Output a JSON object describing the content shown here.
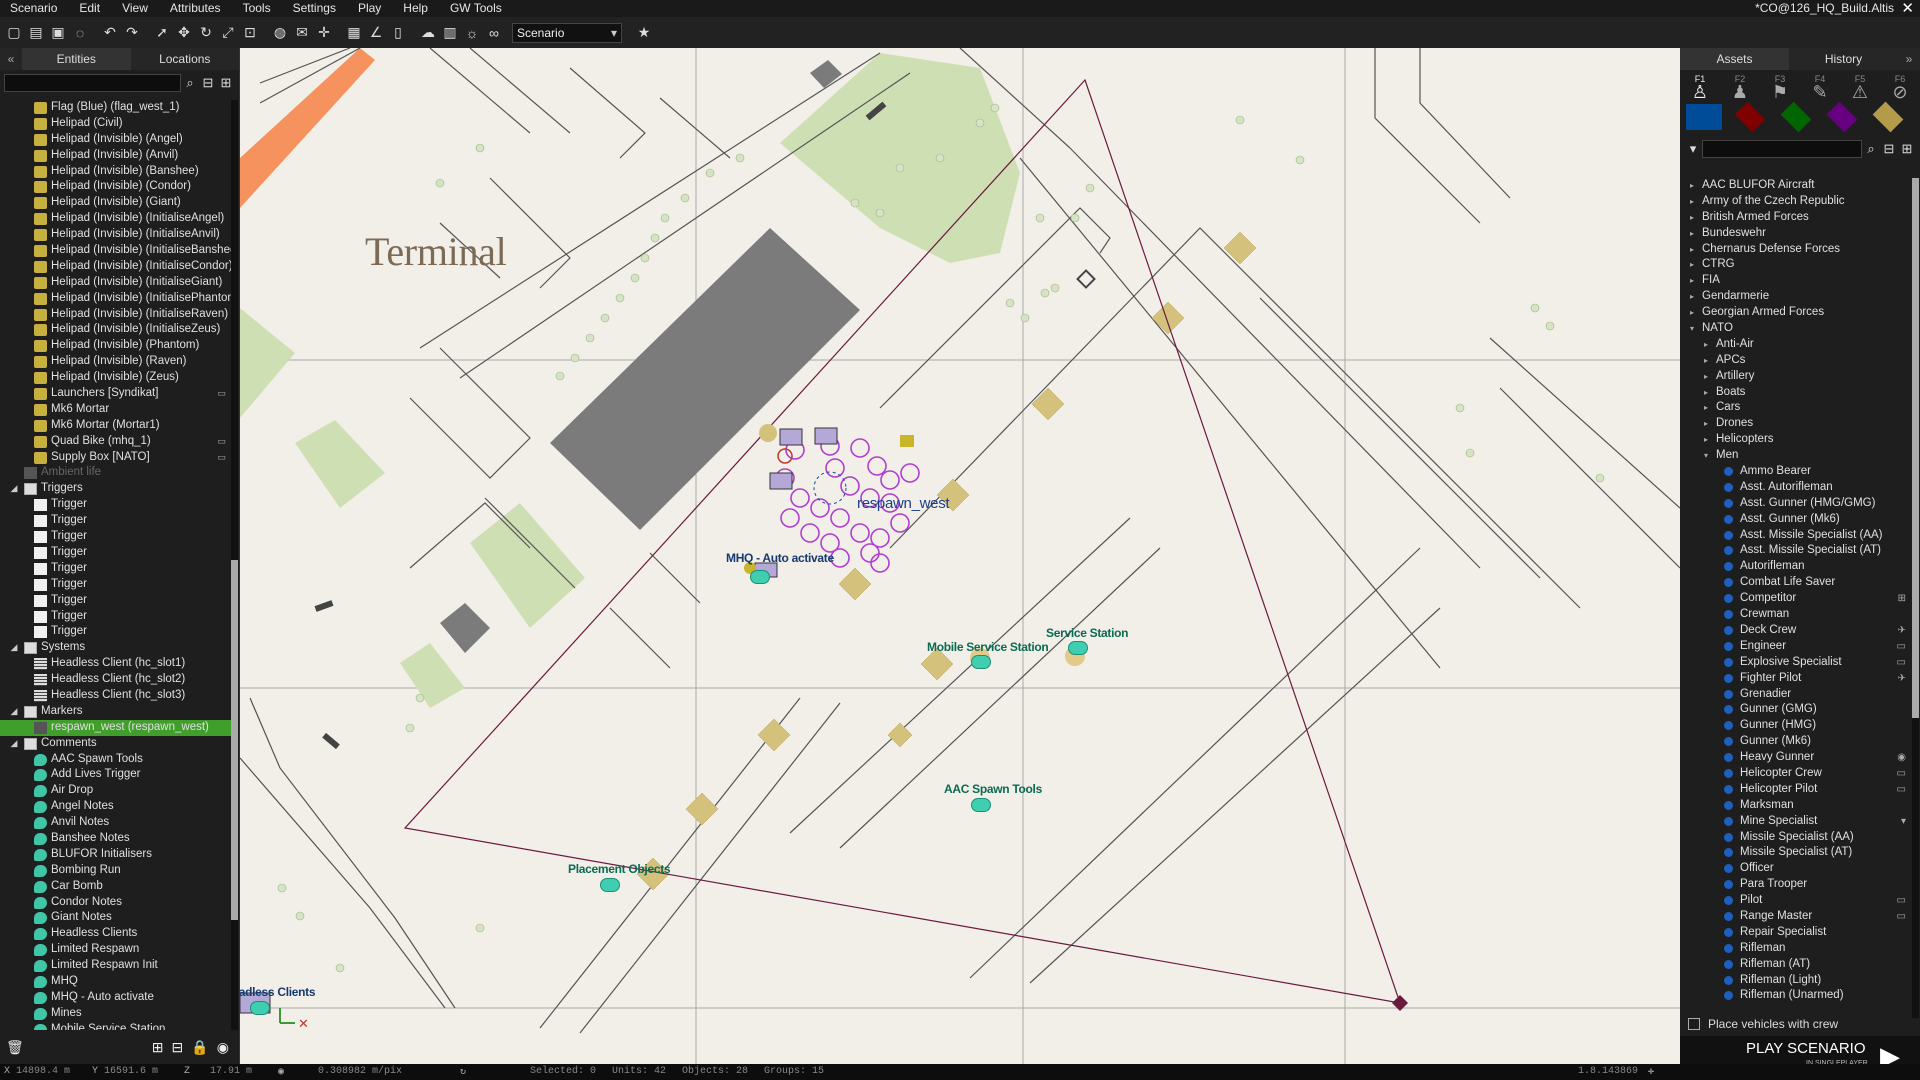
{
  "menu": [
    "Scenario",
    "Edit",
    "View",
    "Attributes",
    "Tools",
    "Settings",
    "Play",
    "Help",
    "GW Tools"
  ],
  "mission_title": "*CO@126_HQ_Build.Altis",
  "toolbar": {
    "layer_select": "Scenario"
  },
  "left_panel": {
    "tabs": [
      "Entities",
      "Locations"
    ],
    "rows": [
      {
        "label": "Flag (Blue) (flag_west_1)",
        "indent": 50,
        "icon": "flag",
        "depth": 2
      },
      {
        "label": "Helipad (Civil)",
        "icon": "flag"
      },
      {
        "label": "Helipad (Invisible) (Angel)",
        "icon": "flag"
      },
      {
        "label": "Helipad (Invisible) (Anvil)",
        "icon": "flag"
      },
      {
        "label": "Helipad (Invisible) (Banshee)",
        "icon": "flag"
      },
      {
        "label": "Helipad (Invisible) (Condor)",
        "icon": "flag"
      },
      {
        "label": "Helipad (Invisible) (Giant)",
        "icon": "flag"
      },
      {
        "label": "Helipad (Invisible) (InitialiseAngel)",
        "icon": "flag"
      },
      {
        "label": "Helipad (Invisible) (InitialiseAnvil)",
        "icon": "flag"
      },
      {
        "label": "Helipad (Invisible) (InitialiseBanshee)",
        "icon": "flag"
      },
      {
        "label": "Helipad (Invisible) (InitialiseCondor)",
        "icon": "flag"
      },
      {
        "label": "Helipad (Invisible) (InitialiseGiant)",
        "icon": "flag"
      },
      {
        "label": "Helipad (Invisible) (InitialisePhantom)",
        "icon": "flag"
      },
      {
        "label": "Helipad (Invisible) (InitialiseRaven)",
        "icon": "flag"
      },
      {
        "label": "Helipad (Invisible) (InitialiseZeus)",
        "icon": "flag"
      },
      {
        "label": "Helipad (Invisible) (Phantom)",
        "icon": "flag"
      },
      {
        "label": "Helipad (Invisible) (Raven)",
        "icon": "flag"
      },
      {
        "label": "Helipad (Invisible) (Zeus)",
        "icon": "flag"
      },
      {
        "label": "Launchers [Syndikat]",
        "icon": "flag",
        "tag": "▭"
      },
      {
        "label": "Mk6 Mortar",
        "icon": "flag"
      },
      {
        "label": "Mk6 Mortar (Mortar1)",
        "icon": "flag"
      },
      {
        "label": "Quad Bike (mhq_1)",
        "icon": "flag",
        "tag": "▭"
      },
      {
        "label": "Supply Box [NATO]",
        "icon": "flag",
        "tag": "▭"
      },
      {
        "label": "Ambient life",
        "icon": "dim",
        "dim": true,
        "lvl": 1
      },
      {
        "label": "Triggers",
        "icon": "folder",
        "lvl": 0,
        "exp": "◢"
      },
      {
        "label": "Trigger",
        "icon": "trig"
      },
      {
        "label": "Trigger",
        "icon": "trig"
      },
      {
        "label": "Trigger",
        "icon": "trig"
      },
      {
        "label": "Trigger",
        "icon": "trig"
      },
      {
        "label": "Trigger",
        "icon": "trig"
      },
      {
        "label": "Trigger",
        "icon": "trig"
      },
      {
        "label": "Trigger",
        "icon": "trig"
      },
      {
        "label": "Trigger",
        "icon": "trig"
      },
      {
        "label": "Trigger",
        "icon": "trig"
      },
      {
        "label": "Systems",
        "icon": "folder",
        "lvl": 0,
        "exp": "◢"
      },
      {
        "label": "Headless Client (hc_slot1)",
        "icon": "hc"
      },
      {
        "label": "Headless Client (hc_slot2)",
        "icon": "hc"
      },
      {
        "label": "Headless Client (hc_slot3)",
        "icon": "hc"
      },
      {
        "label": "Markers",
        "icon": "folder",
        "lvl": 0,
        "exp": "◢"
      },
      {
        "label": "respawn_west (respawn_west)",
        "icon": "dim",
        "selected": true
      },
      {
        "label": "Comments",
        "icon": "folder",
        "lvl": 0,
        "exp": "◢"
      },
      {
        "label": "AAC Spawn Tools",
        "icon": "cmt"
      },
      {
        "label": "Add Lives Trigger",
        "icon": "cmt"
      },
      {
        "label": "Air Drop",
        "icon": "cmt"
      },
      {
        "label": "Angel Notes",
        "icon": "cmt"
      },
      {
        "label": "Anvil Notes",
        "icon": "cmt"
      },
      {
        "label": "Banshee Notes",
        "icon": "cmt"
      },
      {
        "label": "BLUFOR Initialisers",
        "icon": "cmt"
      },
      {
        "label": "Bombing Run",
        "icon": "cmt"
      },
      {
        "label": "Car Bomb",
        "icon": "cmt"
      },
      {
        "label": "Condor Notes",
        "icon": "cmt"
      },
      {
        "label": "Giant Notes",
        "icon": "cmt"
      },
      {
        "label": "Headless Clients",
        "icon": "cmt"
      },
      {
        "label": "Limited Respawn",
        "icon": "cmt"
      },
      {
        "label": "Limited Respawn Init",
        "icon": "cmt"
      },
      {
        "label": "MHQ",
        "icon": "cmt"
      },
      {
        "label": "MHQ - Auto activate",
        "icon": "cmt"
      },
      {
        "label": "Mines",
        "icon": "cmt"
      },
      {
        "label": "Mobile Service Station",
        "icon": "cmt"
      }
    ]
  },
  "map": {
    "location_label": "Terminal",
    "labels": [
      "respawn_west",
      "MHQ - Auto activate",
      "Mobile Service Station",
      "Service Station",
      "AAC Spawn Tools",
      "Placement Objects",
      "Headless Clients"
    ]
  },
  "right_panel": {
    "tabs": [
      "Assets",
      "History"
    ],
    "ftabs": [
      "F1",
      "F2",
      "F3",
      "F4",
      "F5",
      "F6"
    ],
    "side_colors": [
      "#004c99",
      "#7f0000",
      "#006600",
      "#660080",
      "#b39b4a"
    ],
    "rows": [
      {
        "label": "AAC BLUFOR Aircraft",
        "lvl": 0
      },
      {
        "label": "Army of the Czech Republic",
        "lvl": 0
      },
      {
        "label": "British Armed Forces",
        "lvl": 0
      },
      {
        "label": "Bundeswehr",
        "lvl": 0
      },
      {
        "label": "Chernarus Defense Forces",
        "lvl": 0
      },
      {
        "label": "CTRG",
        "lvl": 0
      },
      {
        "label": "FIA",
        "lvl": 0
      },
      {
        "label": "Gendarmerie",
        "lvl": 0
      },
      {
        "label": "Georgian Armed Forces",
        "lvl": 0
      },
      {
        "label": "NATO",
        "lvl": 0,
        "open": true
      },
      {
        "label": "Anti-Air",
        "lvl": 1
      },
      {
        "label": "APCs",
        "lvl": 1
      },
      {
        "label": "Artillery",
        "lvl": 1
      },
      {
        "label": "Boats",
        "lvl": 1
      },
      {
        "label": "Cars",
        "lvl": 1
      },
      {
        "label": "Drones",
        "lvl": 1
      },
      {
        "label": "Helicopters",
        "lvl": 1
      },
      {
        "label": "Men",
        "lvl": 1,
        "open": true
      },
      {
        "label": "Ammo Bearer",
        "lvl": 2
      },
      {
        "label": "Asst. Autorifleman",
        "lvl": 2
      },
      {
        "label": "Asst. Gunner (HMG/GMG)",
        "lvl": 2
      },
      {
        "label": "Asst. Gunner (Mk6)",
        "lvl": 2
      },
      {
        "label": "Asst. Missile Specialist (AA)",
        "lvl": 2
      },
      {
        "label": "Asst. Missile Specialist (AT)",
        "lvl": 2
      },
      {
        "label": "Autorifleman",
        "lvl": 2
      },
      {
        "label": "Combat Life Saver",
        "lvl": 2
      },
      {
        "label": "Competitor",
        "lvl": 2,
        "tag": "⊞"
      },
      {
        "label": "Crewman",
        "lvl": 2
      },
      {
        "label": "Deck Crew",
        "lvl": 2,
        "tag": "✈"
      },
      {
        "label": "Engineer",
        "lvl": 2,
        "tag": "▭"
      },
      {
        "label": "Explosive Specialist",
        "lvl": 2,
        "tag": "▭"
      },
      {
        "label": "Fighter Pilot",
        "lvl": 2,
        "tag": "✈"
      },
      {
        "label": "Grenadier",
        "lvl": 2
      },
      {
        "label": "Gunner (GMG)",
        "lvl": 2
      },
      {
        "label": "Gunner (HMG)",
        "lvl": 2
      },
      {
        "label": "Gunner (Mk6)",
        "lvl": 2
      },
      {
        "label": "Heavy Gunner",
        "lvl": 2,
        "tag": "◉"
      },
      {
        "label": "Helicopter Crew",
        "lvl": 2,
        "tag": "▭"
      },
      {
        "label": "Helicopter Pilot",
        "lvl": 2,
        "tag": "▭"
      },
      {
        "label": "Marksman",
        "lvl": 2
      },
      {
        "label": "Mine Specialist",
        "lvl": 2,
        "tag": "▾"
      },
      {
        "label": "Missile Specialist (AA)",
        "lvl": 2
      },
      {
        "label": "Missile Specialist (AT)",
        "lvl": 2
      },
      {
        "label": "Officer",
        "lvl": 2
      },
      {
        "label": "Para Trooper",
        "lvl": 2
      },
      {
        "label": "Pilot",
        "lvl": 2,
        "tag": "▭"
      },
      {
        "label": "Range Master",
        "lvl": 2,
        "tag": "▭"
      },
      {
        "label": "Repair Specialist",
        "lvl": 2
      },
      {
        "label": "Rifleman",
        "lvl": 2
      },
      {
        "label": "Rifleman (AT)",
        "lvl": 2
      },
      {
        "label": "Rifleman (Light)",
        "lvl": 2
      },
      {
        "label": "Rifleman (Unarmed)",
        "lvl": 2
      }
    ],
    "place_vehicles": "Place vehicles with crew",
    "play": "PLAY SCENARIO",
    "play_sub": "IN SINGLEPLAYER"
  },
  "status": {
    "x": "14898.4 m",
    "y": "16591.6 m",
    "z": "17.91 m",
    "scale": "0.308982 m/pix",
    "selected": "Selected: 0",
    "units": "Units: 42",
    "objects": "Objects: 28",
    "groups": "Groups: 15",
    "version": "1.8.143869"
  }
}
